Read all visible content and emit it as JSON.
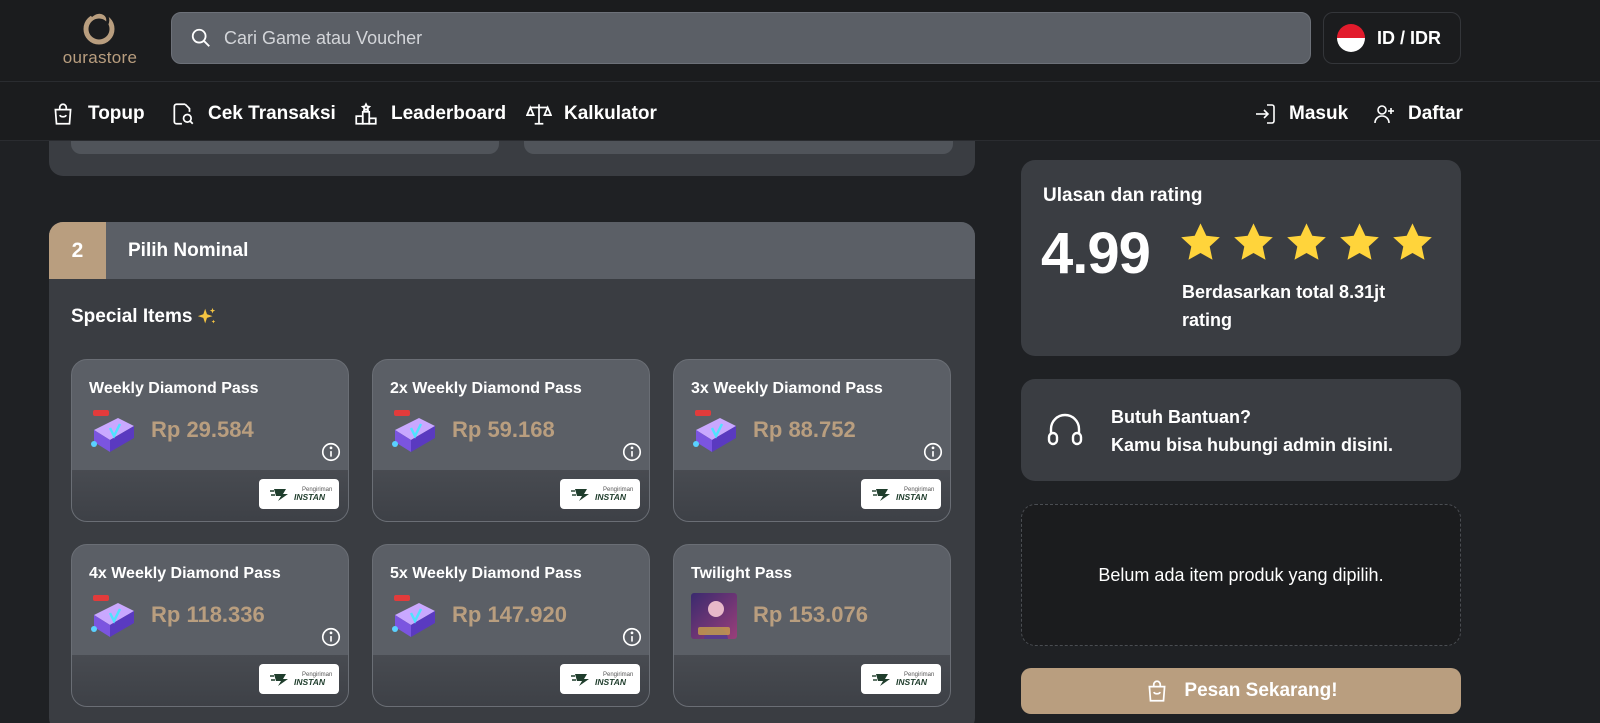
{
  "brand": {
    "logo_text": "ourastore"
  },
  "search": {
    "placeholder": "Cari Game atau Voucher"
  },
  "locale": {
    "label": "ID / IDR"
  },
  "nav": {
    "left": [
      {
        "label": "Topup",
        "icon": "shopping-bag-icon"
      },
      {
        "label": "Cek Transaksi",
        "icon": "search-receipt-icon"
      },
      {
        "label": "Leaderboard",
        "icon": "podium-icon"
      },
      {
        "label": "Kalkulator",
        "icon": "scale-icon"
      }
    ],
    "right": [
      {
        "label": "Masuk",
        "icon": "login-icon"
      },
      {
        "label": "Daftar",
        "icon": "user-plus-icon"
      }
    ]
  },
  "section": {
    "number": "2",
    "title": "Pilih Nominal",
    "subheading": "Special Items",
    "subheading_icon": "sparkles-icon"
  },
  "items": [
    {
      "name": "Weekly Diamond Pass",
      "price": "Rp 29.584",
      "thumb": "diamond-pass",
      "badge_small": "Pengiriman",
      "badge_big": "INSTAN"
    },
    {
      "name": "2x Weekly Diamond Pass",
      "price": "Rp 59.168",
      "thumb": "diamond-pass",
      "badge_small": "Pengiriman",
      "badge_big": "INSTAN"
    },
    {
      "name": "3x Weekly Diamond Pass",
      "price": "Rp 88.752",
      "thumb": "diamond-pass",
      "badge_small": "Pengiriman",
      "badge_big": "INSTAN"
    },
    {
      "name": "4x Weekly Diamond Pass",
      "price": "Rp 118.336",
      "thumb": "diamond-pass",
      "badge_small": "Pengiriman",
      "badge_big": "INSTAN"
    },
    {
      "name": "5x Weekly Diamond Pass",
      "price": "Rp 147.920",
      "thumb": "diamond-pass",
      "badge_small": "Pengiriman",
      "badge_big": "INSTAN"
    },
    {
      "name": "Twilight Pass",
      "price": "Rp 153.076",
      "thumb": "game-art",
      "badge_small": "Pengiriman",
      "badge_big": "INSTAN"
    }
  ],
  "rating": {
    "title": "Ulasan dan rating",
    "value": "4.99",
    "stars": 5,
    "note": "Berdasarkan total 8.31jt rating"
  },
  "help": {
    "title": "Butuh Bantuan?",
    "subtitle": "Kamu bisa hubungi admin disini."
  },
  "summary": {
    "empty_text": "Belum ada item produk yang dipilih."
  },
  "order": {
    "label": "Pesan Sekarang!"
  },
  "colors": {
    "accent": "#b99e7f",
    "background": "#1f2124",
    "card": "#5b5f66",
    "panel": "#3a3d42",
    "star": "#ffd43b"
  }
}
